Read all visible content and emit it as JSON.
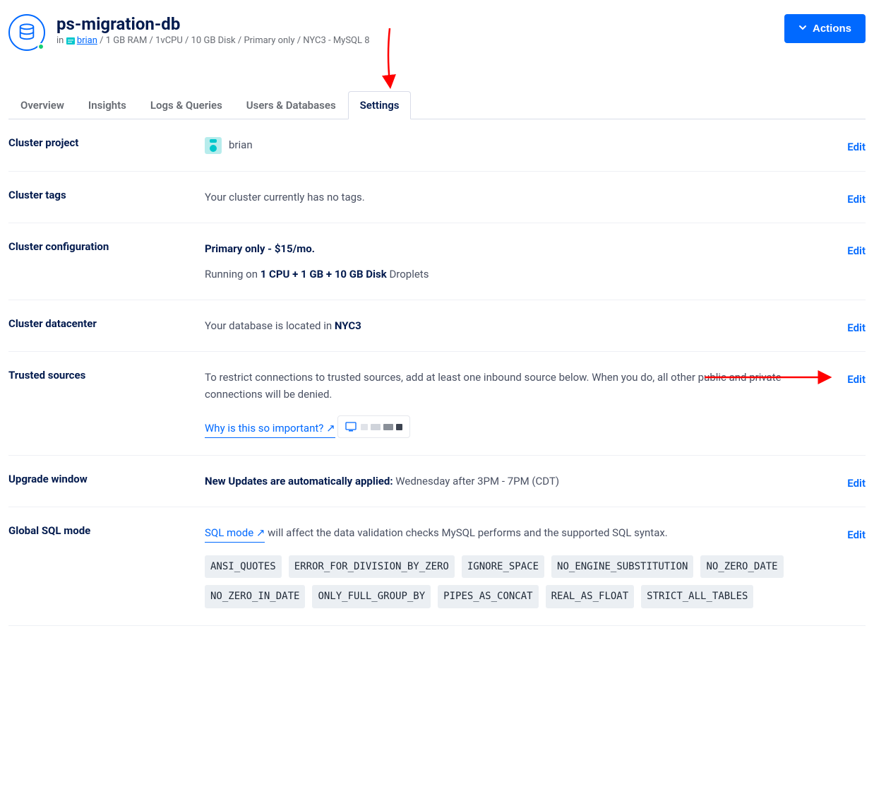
{
  "header": {
    "title": "ps-migration-db",
    "in_label": "in",
    "project_link": "brian",
    "specs": " / 1 GB RAM / 1vCPU / 10 GB Disk / Primary only / NYC3 - MySQL 8",
    "actions_label": "Actions"
  },
  "tabs": [
    "Overview",
    "Insights",
    "Logs & Queries",
    "Users & Databases",
    "Settings"
  ],
  "active_tab": "Settings",
  "edit_label": "Edit",
  "sections": {
    "cluster_project": {
      "label": "Cluster project",
      "value": "brian"
    },
    "cluster_tags": {
      "label": "Cluster tags",
      "value": "Your cluster currently has no tags."
    },
    "cluster_config": {
      "label": "Cluster configuration",
      "line1_prefix": "Primary only - ",
      "line1_bold": "$15/mo.",
      "line2_prefix": "Running on ",
      "line2_bold": "1 CPU + 1 GB + 10 GB Disk",
      "line2_suffix": " Droplets"
    },
    "cluster_datacenter": {
      "label": "Cluster datacenter",
      "prefix": "Your database is located in ",
      "value": "NYC3"
    },
    "trusted_sources": {
      "label": "Trusted sources",
      "desc": "To restrict connections to trusted sources, add at least one inbound source below. When you do, all other public and private connections will be denied.",
      "link": "Why is this so important? ↗"
    },
    "upgrade_window": {
      "label": "Upgrade window",
      "bold": "New Updates are automatically applied:",
      "suffix": " Wednesday after 3PM - 7PM (CDT)"
    },
    "global_sql": {
      "label": "Global SQL mode",
      "link": "SQL mode ↗",
      "suffix": "  will affect the data validation checks MySQL performs and the supported SQL syntax.",
      "tags": [
        "ANSI_QUOTES",
        "ERROR_FOR_DIVISION_BY_ZERO",
        "IGNORE_SPACE",
        "NO_ENGINE_SUBSTITUTION",
        "NO_ZERO_DATE",
        "NO_ZERO_IN_DATE",
        "ONLY_FULL_GROUP_BY",
        "PIPES_AS_CONCAT",
        "REAL_AS_FLOAT",
        "STRICT_ALL_TABLES"
      ]
    }
  }
}
